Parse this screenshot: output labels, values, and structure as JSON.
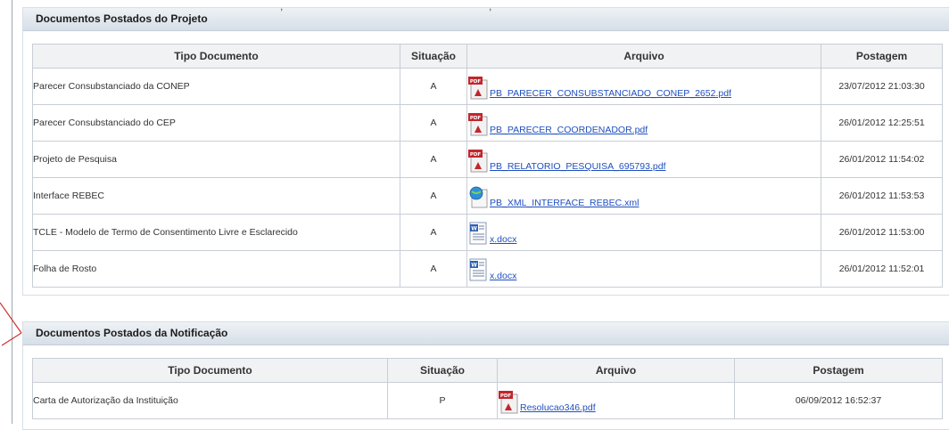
{
  "panels": [
    {
      "title": "Documentos Postados do Projeto",
      "headers": {
        "tipo": "Tipo Documento",
        "situacao": "Situação",
        "arquivo": "Arquivo",
        "postagem": "Postagem"
      },
      "rows": [
        {
          "tipo": "Parecer Consubstanciado da CONEP",
          "situacao": "A",
          "arquivo": "PB_PARECER_CONSUBSTANCIADO_CONEP_2652.pdf",
          "icon": "pdf-icon",
          "postagem": "23/07/2012 21:03:30"
        },
        {
          "tipo": "Parecer Consubstanciado do CEP",
          "situacao": "A",
          "arquivo": "PB_PARECER_COORDENADOR.pdf",
          "icon": "pdf-icon",
          "postagem": "26/01/2012 12:25:51"
        },
        {
          "tipo": "Projeto de Pesquisa",
          "situacao": "A",
          "arquivo": "PB_RELATORIO_PESQUISA_695793.pdf",
          "icon": "pdf-icon",
          "postagem": "26/01/2012 11:54:02"
        },
        {
          "tipo": "Interface REBEC",
          "situacao": "A",
          "arquivo": "PB_XML_INTERFACE_REBEC.xml",
          "icon": "xml-icon",
          "postagem": "26/01/2012 11:53:53"
        },
        {
          "tipo": "TCLE - Modelo de Termo de Consentimento Livre e Esclarecido",
          "situacao": "A",
          "arquivo": "x.docx",
          "icon": "word-doc-icon",
          "postagem": "26/01/2012 11:53:00"
        },
        {
          "tipo": "Folha de Rosto",
          "situacao": "A",
          "arquivo": "x.docx",
          "icon": "word-doc-icon",
          "postagem": "26/01/2012 11:52:01"
        }
      ]
    },
    {
      "title": "Documentos Postados da Notificação",
      "headers": {
        "tipo": "Tipo Documento",
        "situacao": "Situação",
        "arquivo": "Arquivo",
        "postagem": "Postagem"
      },
      "rows": [
        {
          "tipo": "Carta de Autorização da Instituição",
          "situacao": "P",
          "arquivo": "Resolucao346.pdf",
          "icon": "pdf-icon",
          "postagem": "06/09/2012 16:52:37"
        }
      ]
    }
  ],
  "colors": {
    "link": "#1f4fbf",
    "header_gradient_top": "#eef2f6",
    "header_gradient_bottom": "#d6dee7",
    "border": "#c8ced5",
    "arrow": "#d0312d",
    "pdf_red": "#c0272d"
  }
}
